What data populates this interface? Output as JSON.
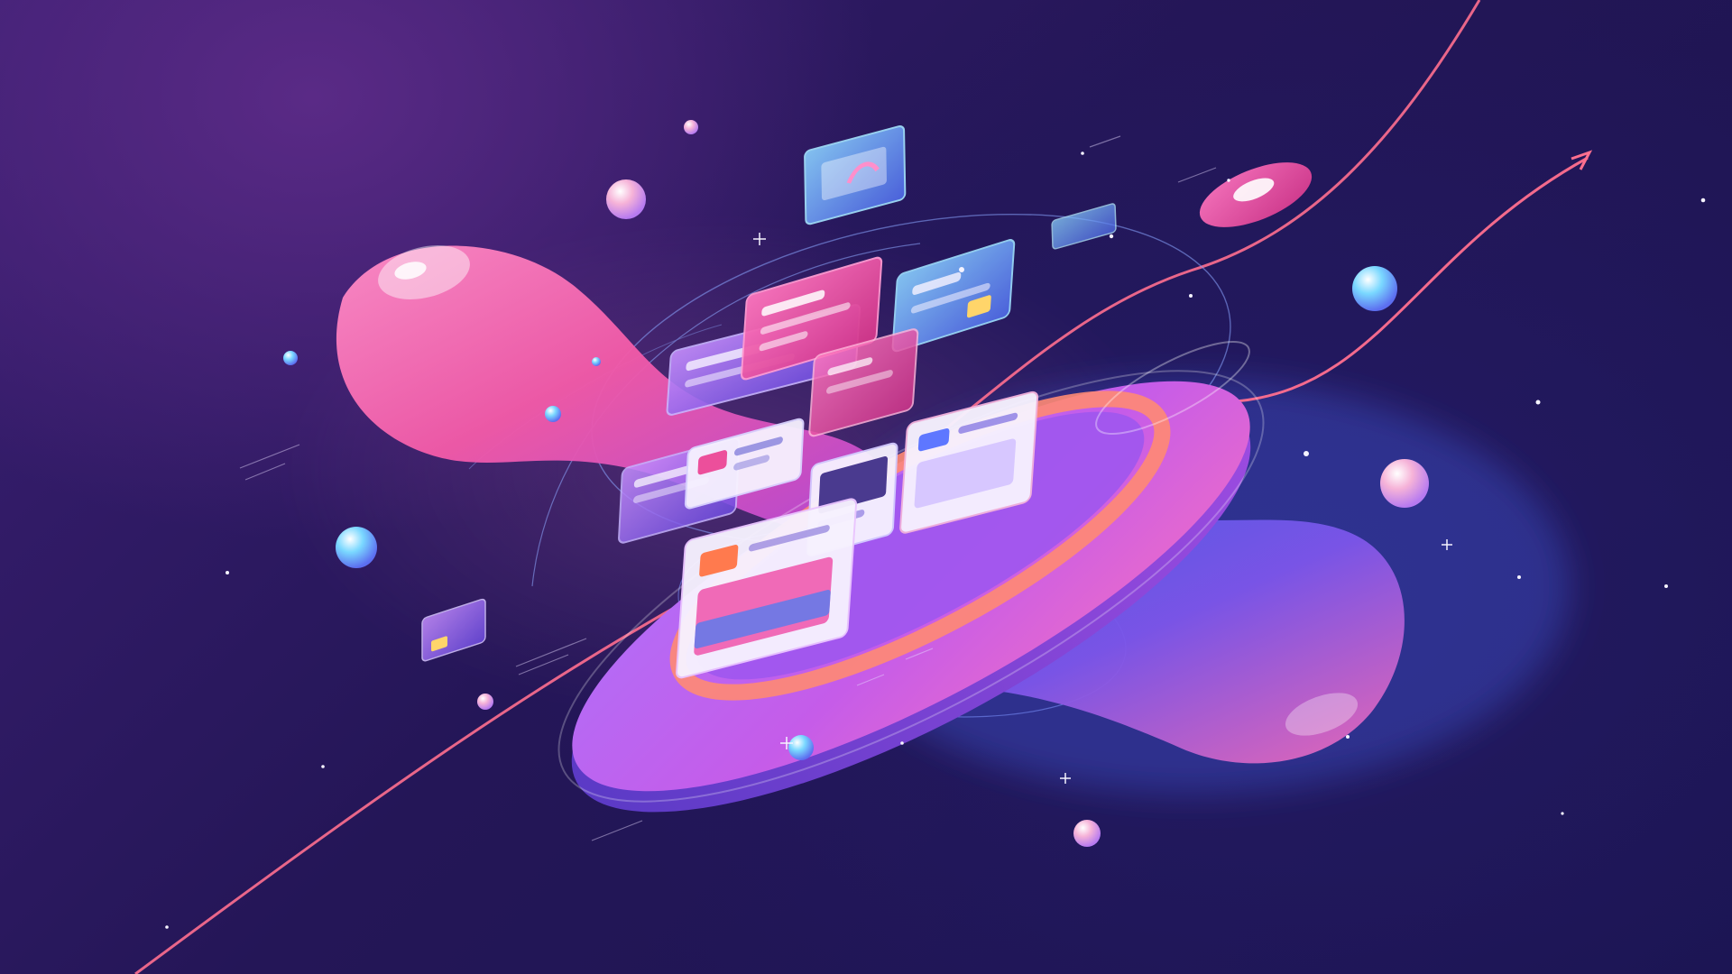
{
  "colors": {
    "background_top": "#3c1f73",
    "background_bottom": "#1a1450",
    "blob_pink": "#f25aa8",
    "blob_blue": "#3f63e6",
    "disc_purple": "#b25cf0",
    "disc_ring_orange": "#ff8a73",
    "trend_line": "#ff6f8f",
    "panel_pink": "#ec4f9b",
    "panel_blue": "#6fb6ff",
    "panel_white": "#f7f2ff"
  },
  "icons": [
    "trend-arrow-icon",
    "sparkle-icon",
    "orb-icon",
    "floating-card-icon"
  ]
}
